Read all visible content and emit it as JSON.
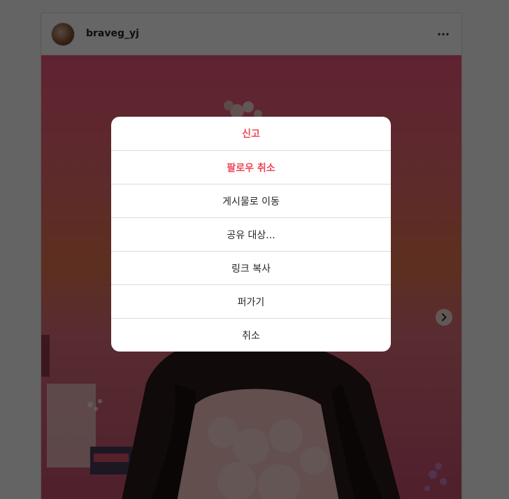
{
  "post": {
    "username": "braveg_yj",
    "more_icon": "more-horizontal-icon",
    "next_icon": "chevron-right-icon"
  },
  "dialog": {
    "items": [
      {
        "label": "신고",
        "style": "danger"
      },
      {
        "label": "팔로우 취소",
        "style": "danger"
      },
      {
        "label": "게시물로 이동",
        "style": "normal"
      },
      {
        "label": "공유 대상...",
        "style": "normal"
      },
      {
        "label": "링크 복사",
        "style": "normal"
      },
      {
        "label": "퍼가기",
        "style": "normal"
      },
      {
        "label": "취소",
        "style": "normal"
      }
    ]
  },
  "colors": {
    "danger": "#ed4956",
    "overlay": "rgba(0,0,0,0.6)"
  }
}
